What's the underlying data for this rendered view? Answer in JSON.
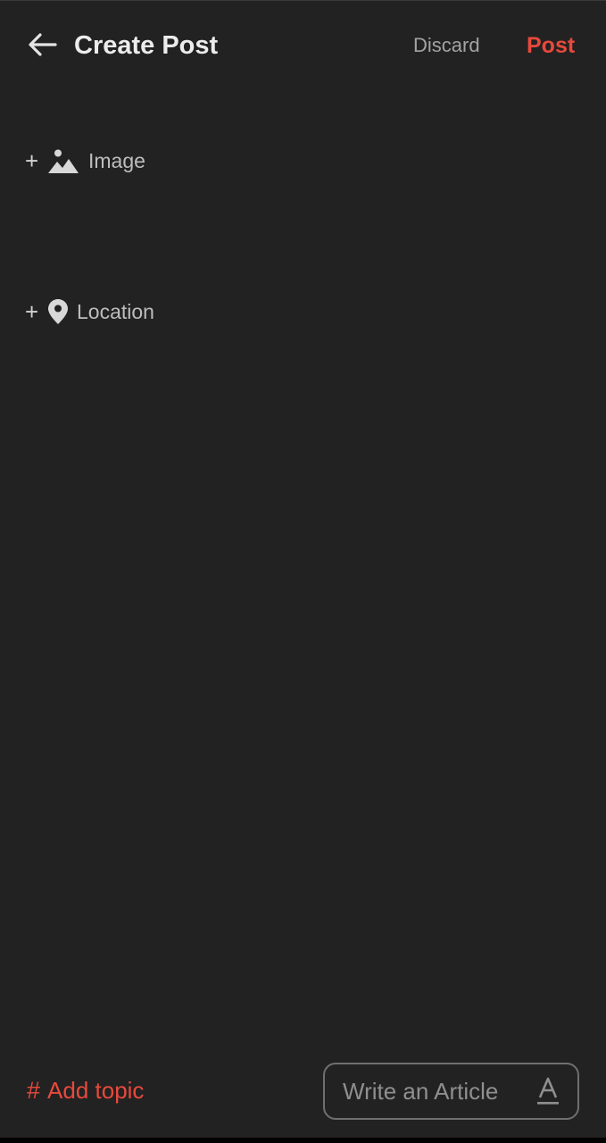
{
  "header": {
    "back_icon": "arrow-left-icon",
    "title": "Create Post",
    "discard_label": "Discard",
    "post_label": "Post"
  },
  "options": {
    "image": {
      "plus": "+",
      "icon": "image-icon",
      "label": "Image"
    },
    "location": {
      "plus": "+",
      "icon": "location-pin-icon",
      "label": "Location"
    }
  },
  "footer": {
    "topic_hash": "#",
    "add_topic_label": "Add topic",
    "write_article_label": "Write an Article",
    "write_article_icon": "text-format-icon"
  },
  "colors": {
    "background": "#222222",
    "accent": "#e8493c",
    "title": "#ececec",
    "muted": "#a3a3a3"
  }
}
